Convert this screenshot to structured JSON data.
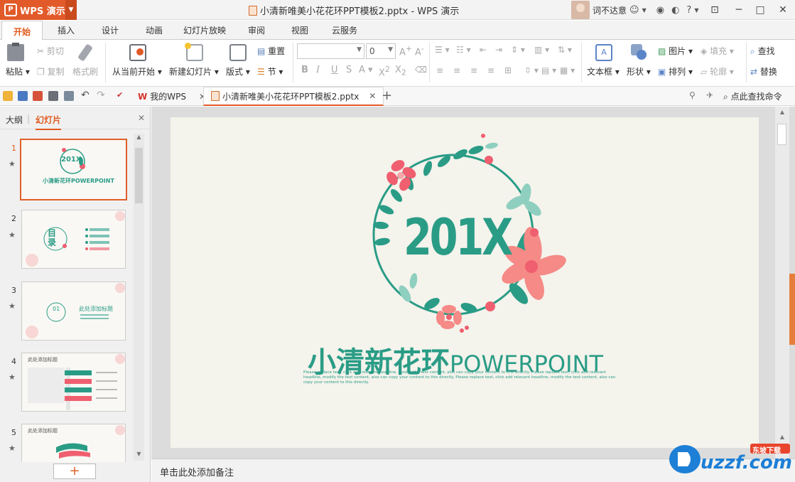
{
  "app": {
    "menu_label": "WPS 演示",
    "window_title": "小清新唯美小花花环PPT模板2.pptx - WPS 演示",
    "user_name": "词不达意"
  },
  "tabs": [
    "开始",
    "插入",
    "设计",
    "动画",
    "幻灯片放映",
    "审阅",
    "视图",
    "云服务"
  ],
  "ribbon": {
    "paste": "粘贴",
    "cut": "剪切",
    "copy": "复制",
    "format_painter": "格式刷",
    "from_current": "从当前开始",
    "new_slide": "新建幻灯片",
    "layout": "版式",
    "reset": "重置",
    "section": "节",
    "font_size": "0",
    "textbox": "文本框",
    "shape": "形状",
    "picture": "图片",
    "fill": "填充",
    "arrange": "排列",
    "outline": "轮廓",
    "find": "查找",
    "replace": "替换"
  },
  "quickbar": {
    "tab_home": "我的WPS",
    "tab_doc": "小清新唯美小花花环PPT模板2.pptx",
    "search": "点此查找命令"
  },
  "panel": {
    "tab_outline": "大纲",
    "tab_slides": "幻灯片",
    "slide_numbers": [
      "1",
      "2",
      "3",
      "4",
      "5"
    ]
  },
  "slide": {
    "year": "201X",
    "title_cn": "小清新花环",
    "title_en": "POWERPOINT",
    "body": "Please replace text, click add relevant headline, modify the text content, also can copy your content to this directly. Please replace text, click add relevant headline, modify the text content, also can copy your content to this directly. Please replace text, click add relevant headline, modify the text content, also can copy your content to this directly."
  },
  "thumbs": {
    "t1_year": "201X",
    "t1_title": "小清新花环POWERPOINT",
    "t2_title": "目录",
    "t3_num": "01",
    "t3_title": "此处添加标题",
    "t4_title": "此处添加标题",
    "t5_title": "此处添加标题"
  },
  "notes": "单击此处添加备注",
  "watermark": {
    "text": "uzzf.com",
    "tag": "东坡下载"
  },
  "colors": {
    "accent": "#e25a29",
    "teal": "#2a9c86",
    "coral": "#ef5f6f"
  }
}
